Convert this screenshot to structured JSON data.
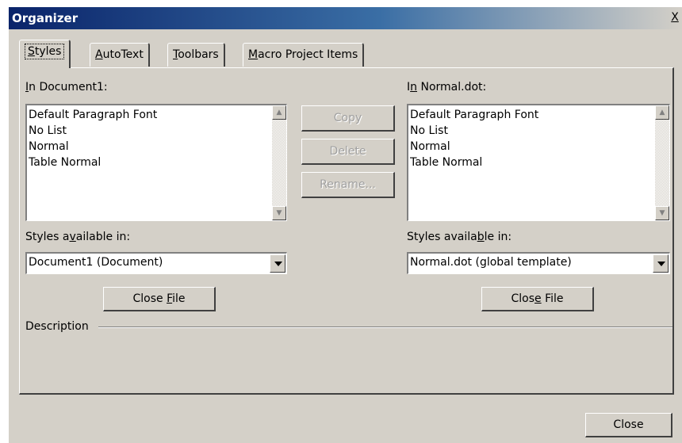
{
  "window": {
    "title": "Organizer",
    "close_glyph": "X"
  },
  "tabs": [
    {
      "label": "Styles",
      "accel": "S",
      "rest": "tyles",
      "active": true
    },
    {
      "label": "AutoText",
      "accel": "A",
      "rest": "utoText"
    },
    {
      "label": "Toolbars",
      "accel": "T",
      "rest": "oolbars"
    },
    {
      "label": "Macro Project Items",
      "accel": "M",
      "rest": "acro Project Items"
    }
  ],
  "left": {
    "heading_pre": "",
    "heading_accel": "I",
    "heading_post": "n Document1:",
    "items": [
      "Default Paragraph Font",
      "No List",
      "Normal",
      "Table Normal"
    ],
    "avail_pre": "Styles a",
    "avail_accel": "v",
    "avail_post": "ailable in:",
    "combo_value": "Document1 (Document)",
    "close_pre": "Close ",
    "close_accel": "F",
    "close_post": "ile"
  },
  "right": {
    "heading_pre": "I",
    "heading_accel": "n",
    "heading_post": " Normal.dot:",
    "items": [
      "Default Paragraph Font",
      "No List",
      "Normal",
      "Table Normal"
    ],
    "avail_pre": "Styles availa",
    "avail_accel": "b",
    "avail_post": "le in:",
    "combo_value": "Normal.dot (global template)",
    "close_pre": "Clos",
    "close_accel": "e",
    "close_post": " File"
  },
  "actions": {
    "copy": "Copy",
    "delete": "Delete",
    "rename": "Rename..."
  },
  "description_label": "Description",
  "close_button": "Close",
  "icons": {
    "scroll_up": "▲",
    "scroll_down": "▼"
  }
}
